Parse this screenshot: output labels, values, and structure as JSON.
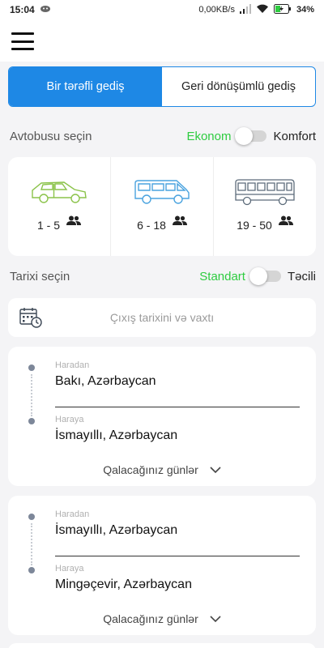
{
  "status_bar": {
    "time": "15:04",
    "network_speed": "0,00KB/s",
    "battery": "34%"
  },
  "header": {
    "menu_icon": "hamburger-menu-icon"
  },
  "trip_type": {
    "options": [
      "Bir tərəfli gediş",
      "Geri dönüşümlü gediş"
    ],
    "selected": "Bir tərəfli gediş"
  },
  "bus_section": {
    "label": "Avtobusu seçin",
    "toggle_on_label": "Ekonom",
    "toggle_off_label": "Komfort",
    "options": [
      {
        "capacity": "1 - 5",
        "icon": "car-icon",
        "color": "#8bc34a"
      },
      {
        "capacity": "6 - 18",
        "icon": "minibus-icon",
        "color": "#4aa3df"
      },
      {
        "capacity": "19 - 50",
        "icon": "bus-icon",
        "color": "#5c6b7a"
      }
    ]
  },
  "date_section": {
    "label": "Tarixi seçin",
    "toggle_on_label": "Standart",
    "toggle_off_label": "Təcili",
    "placeholder": "Çıxış tarixini və vaxtı",
    "icon": "calendar-clock-icon"
  },
  "routes": [
    {
      "from_label": "Haradan",
      "from_value": "Bakı, Azərbaycan",
      "to_label": "Haraya",
      "to_value": "İsmayıllı, Azərbaycan",
      "days_label": "Qalacağınız günlər"
    },
    {
      "from_label": "Haradan",
      "from_value": "İsmayıllı, Azərbaycan",
      "to_label": "Haraya",
      "to_value": "Mingəçevir, Azərbaycan",
      "days_label": "Qalacağınız günlər"
    }
  ],
  "colors": {
    "accent": "#1e88e5",
    "green": "#2ecc40",
    "background": "#f4f4f6"
  }
}
